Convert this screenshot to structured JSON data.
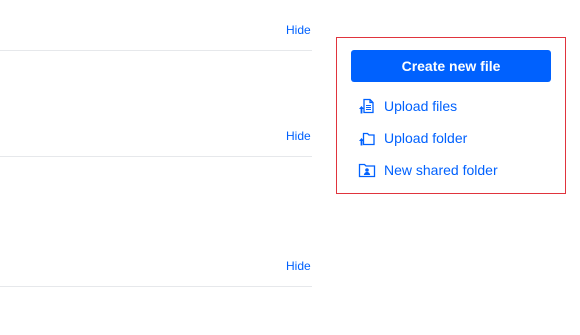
{
  "sections": [
    {
      "hide_label": "Hide"
    },
    {
      "hide_label": "Hide"
    },
    {
      "hide_label": "Hide"
    }
  ],
  "actions": {
    "create_label": "Create new file",
    "items": [
      {
        "label": "Upload files",
        "icon": "upload-file-icon"
      },
      {
        "label": "Upload folder",
        "icon": "upload-folder-icon"
      },
      {
        "label": "New shared folder",
        "icon": "shared-folder-icon"
      }
    ]
  },
  "colors": {
    "accent": "#0061fe",
    "highlight_border": "#e0343d",
    "divider": "#e6e8eb"
  }
}
